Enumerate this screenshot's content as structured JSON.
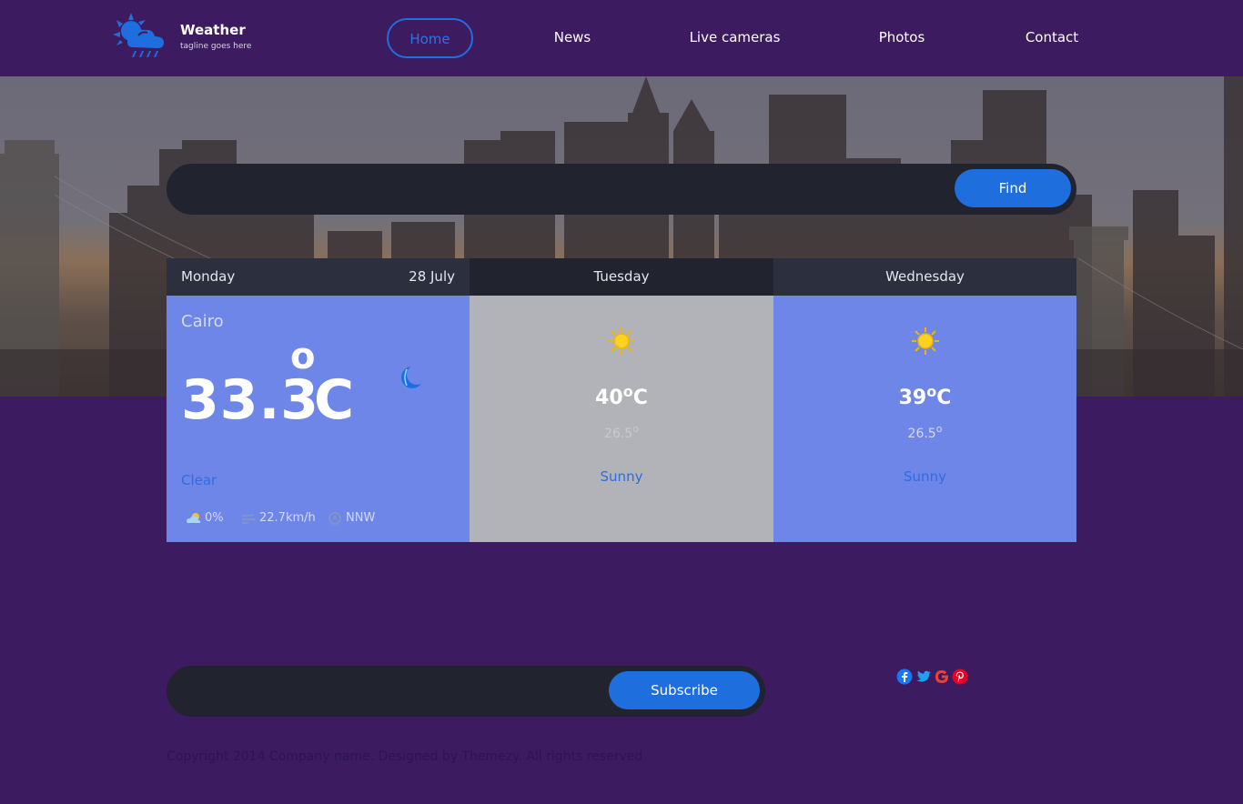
{
  "brand": {
    "title": "Weather",
    "tagline": "tagline goes here",
    "icon": "weather-logo-icon"
  },
  "nav": {
    "items": [
      "Home",
      "News",
      "Live cameras",
      "Photos",
      "Contact"
    ],
    "active": "Home"
  },
  "search": {
    "value": "",
    "placeholder": "",
    "button_label": "Find"
  },
  "forecast": {
    "today": {
      "day": "Monday",
      "date": "28 July",
      "city": "Cairo",
      "temperature": "33.3",
      "degree": "o",
      "unit": "C",
      "icon": "moon-icon",
      "condition": "Clear",
      "precipitation": "0%",
      "wind_speed": "22.7km/h",
      "wind_direction": "NNW"
    },
    "days": [
      {
        "day": "Tuesday",
        "max": "40",
        "max_degree": "o",
        "max_unit": "C",
        "min": "26.5",
        "min_degree": "o",
        "condition": "Sunny",
        "icon": "sun-icon"
      },
      {
        "day": "Wednesday",
        "max": "39",
        "max_degree": "o",
        "max_unit": "C",
        "min": "26.5",
        "min_degree": "o",
        "condition": "Sunny",
        "icon": "sun-icon"
      }
    ]
  },
  "subscribe": {
    "value": "",
    "placeholder": "",
    "button_label": "Subscribe"
  },
  "social": [
    "facebook-icon",
    "twitter-icon",
    "google-icon",
    "pinterest-icon"
  ],
  "footer": {
    "copyright": "Copyright 2014 Company name. Designed by Themezy. All rights reserved"
  },
  "colors": {
    "background": "#3c1b61",
    "accent": "#1e6fdd",
    "card_blue": "#6e86e8",
    "card_gray": "#b2b3b8",
    "dark_panel": "#21232f"
  }
}
